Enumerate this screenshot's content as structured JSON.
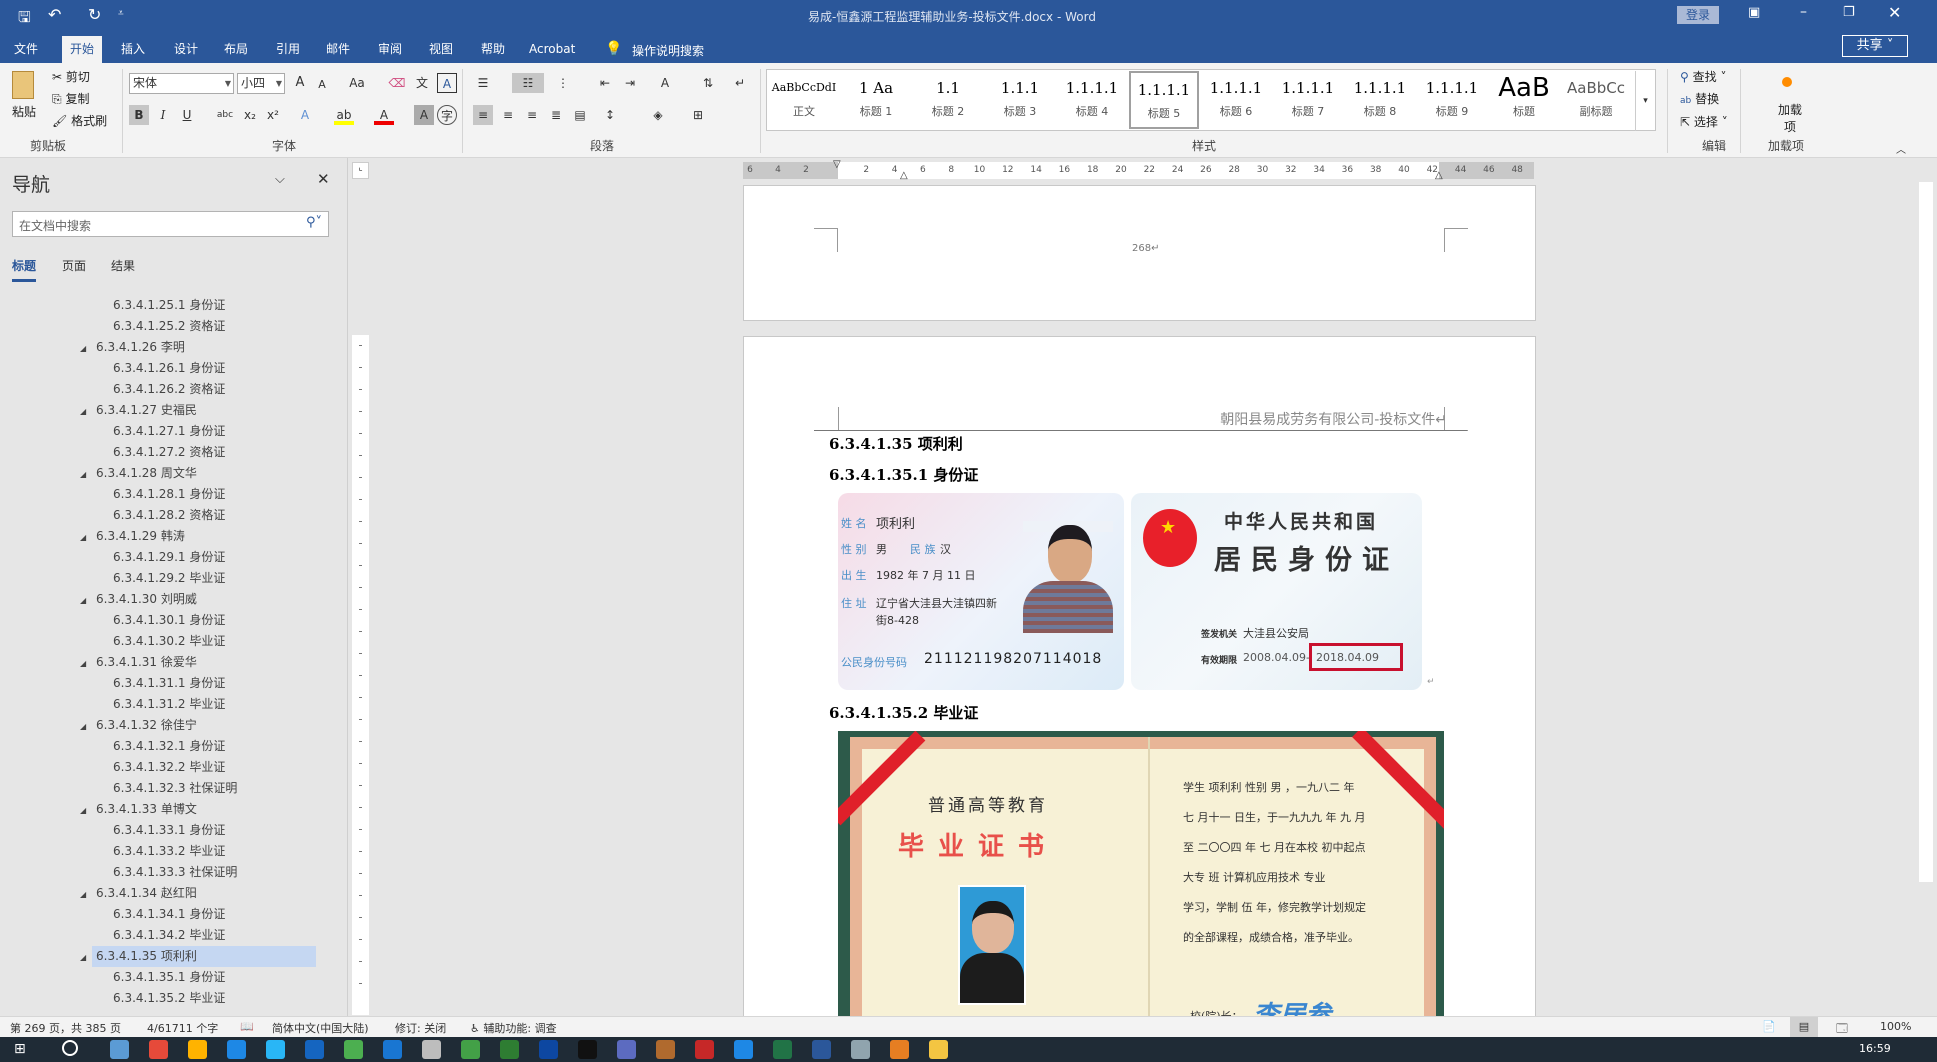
{
  "titlebar": {
    "title": "易成-恒鑫源工程监理辅助业务-投标文件.docx  -  Word",
    "login": "登录"
  },
  "tabs": [
    "文件",
    "开始",
    "插入",
    "设计",
    "布局",
    "引用",
    "邮件",
    "审阅",
    "视图",
    "帮助",
    "Acrobat"
  ],
  "tell_me": "操作说明搜索",
  "share": "共享",
  "ribbon": {
    "clipboard": {
      "paste": "粘贴",
      "cut": "剪切",
      "copy": "复制",
      "format_painter": "格式刷",
      "label": "剪贴板"
    },
    "font": {
      "name": "宋体",
      "size": "小四",
      "label": "字体",
      "grow": "A",
      "shrink": "A",
      "case": "Aa",
      "bold": "B",
      "italic": "I",
      "underline": "U",
      "strike": "abc",
      "sub": "x₂",
      "sup": "x²"
    },
    "paragraph": {
      "label": "段落"
    },
    "styles": {
      "label": "样式",
      "items": [
        {
          "preview": "AaBbCcDdI",
          "name": "正文"
        },
        {
          "preview": "1   Aa",
          "name": "标题 1"
        },
        {
          "preview": "1.1",
          "name": "标题 2"
        },
        {
          "preview": "1.1.1",
          "name": "标题 3"
        },
        {
          "preview": "1.1.1.1",
          "name": "标题 4"
        },
        {
          "preview": "1.1.1.1",
          "name": "标题 5"
        },
        {
          "preview": "1.1.1.1",
          "name": "标题 6"
        },
        {
          "preview": "1.1.1.1",
          "name": "标题 7"
        },
        {
          "preview": "1.1.1.1",
          "name": "标题 8"
        },
        {
          "preview": "1.1.1.1",
          "name": "标题 9"
        },
        {
          "preview": "AaB",
          "name": "标题"
        },
        {
          "preview": "AaBbCc",
          "name": "副标题"
        }
      ],
      "selected": 5
    },
    "editing": {
      "find": "查找",
      "replace": "替换",
      "select": "选择",
      "label": "编辑"
    },
    "addins": {
      "button": "加载项",
      "label": "加载项"
    }
  },
  "nav": {
    "title": "导航",
    "search_placeholder": "在文档中搜索",
    "tabs": [
      "标题",
      "页面",
      "结果"
    ],
    "items": [
      {
        "level": 2,
        "text": "6.3.4.1.25.1 身份证"
      },
      {
        "level": 2,
        "text": "6.3.4.1.25.2 资格证"
      },
      {
        "level": 1,
        "text": "6.3.4.1.26 李明"
      },
      {
        "level": 2,
        "text": "6.3.4.1.26.1 身份证"
      },
      {
        "level": 2,
        "text": "6.3.4.1.26.2 资格证"
      },
      {
        "level": 1,
        "text": "6.3.4.1.27 史福民"
      },
      {
        "level": 2,
        "text": "6.3.4.1.27.1 身份证"
      },
      {
        "level": 2,
        "text": "6.3.4.1.27.2 资格证"
      },
      {
        "level": 1,
        "text": "6.3.4.1.28 周文华"
      },
      {
        "level": 2,
        "text": "6.3.4.1.28.1 身份证"
      },
      {
        "level": 2,
        "text": "6.3.4.1.28.2 资格证"
      },
      {
        "level": 1,
        "text": "6.3.4.1.29 韩涛"
      },
      {
        "level": 2,
        "text": "6.3.4.1.29.1 身份证"
      },
      {
        "level": 2,
        "text": "6.3.4.1.29.2 毕业证"
      },
      {
        "level": 1,
        "text": "6.3.4.1.30 刘明威"
      },
      {
        "level": 2,
        "text": "6.3.4.1.30.1 身份证"
      },
      {
        "level": 2,
        "text": "6.3.4.1.30.2 毕业证"
      },
      {
        "level": 1,
        "text": "6.3.4.1.31 徐爱华"
      },
      {
        "level": 2,
        "text": "6.3.4.1.31.1 身份证"
      },
      {
        "level": 2,
        "text": "6.3.4.1.31.2 毕业证"
      },
      {
        "level": 1,
        "text": "6.3.4.1.32 徐佳宁"
      },
      {
        "level": 2,
        "text": "6.3.4.1.32.1 身份证"
      },
      {
        "level": 2,
        "text": "6.3.4.1.32.2 毕业证"
      },
      {
        "level": 2,
        "text": "6.3.4.1.32.3 社保证明"
      },
      {
        "level": 1,
        "text": "6.3.4.1.33 单博文"
      },
      {
        "level": 2,
        "text": "6.3.4.1.33.1 身份证"
      },
      {
        "level": 2,
        "text": "6.3.4.1.33.2 毕业证"
      },
      {
        "level": 2,
        "text": "6.3.4.1.33.3 社保证明"
      },
      {
        "level": 1,
        "text": "6.3.4.1.34 赵红阳"
      },
      {
        "level": 2,
        "text": "6.3.4.1.34.1 身份证"
      },
      {
        "level": 2,
        "text": "6.3.4.1.34.2 毕业证"
      },
      {
        "level": 1,
        "text": "6.3.4.1.35 项利利",
        "selected": true
      },
      {
        "level": 2,
        "text": "6.3.4.1.35.1 身份证"
      },
      {
        "level": 2,
        "text": "6.3.4.1.35.2 毕业证"
      }
    ]
  },
  "ruler": {
    "numbers": [
      "6",
      "4",
      "2",
      "2",
      "4",
      "6",
      "8",
      "10",
      "12",
      "14",
      "16",
      "18",
      "20",
      "22",
      "24",
      "26",
      "28",
      "30",
      "32",
      "34",
      "36",
      "38",
      "40",
      "42",
      "44",
      "46",
      "48"
    ]
  },
  "document": {
    "page_number": "268↵",
    "header": "朝阳县易成劳务有限公司-投标文件↵",
    "h1": "6.3.4.1.35 项利利",
    "h2": "6.3.4.1.35.1   身份证",
    "h3": "6.3.4.1.35.2   毕业证",
    "idcard_front": {
      "name_label": "姓 名",
      "name": "项利利",
      "sex_label": "性 别",
      "sex": "男",
      "eth_label": "民 族",
      "eth": "汉",
      "birth_label": "出 生",
      "birth": "1982 年 7 月 11 日",
      "addr_label": "住 址",
      "addr1": "辽宁省大洼县大洼镇四新",
      "addr2": "街8-428",
      "id_label": "公民身份号码",
      "id": "211121198207114018"
    },
    "idcard_back": {
      "title1": "中华人民共和国",
      "title2": "居民身份证",
      "issuer_label": "签发机关",
      "issuer": "大洼县公安局",
      "valid_label": "有效期限",
      "valid_from": "2008.04.09-",
      "valid_to": "2018.04.09"
    },
    "diploma": {
      "org": "普通高等教育",
      "title": "毕业证书",
      "lines": [
        "学生 项利利  性别 男 ，一九八二 年",
        "七 月十一 日生，于一九九九 年 九  月",
        "至 二〇〇四 年 七  月在本校 初中起点",
        "大专   班 计算机应用技术      专业",
        "学习，学制 伍 年，修完教学计划规定",
        "的全部课程，成绩合格，准予毕业。"
      ],
      "president": "校(院)长：",
      "signature": "李居参"
    }
  },
  "status": {
    "page": "第 269 页，共 385 页",
    "words": "4/61711 个字",
    "language": "简体中文(中国大陆)",
    "track": "修订: 关闭",
    "accessibility": "辅助功能: 调查",
    "zoom": "100%"
  },
  "taskbar": {
    "time": "16:59"
  },
  "colors": {
    "brand": "#2b579a",
    "highlight": "#c5d7f2",
    "redbox": "#c8102e"
  }
}
